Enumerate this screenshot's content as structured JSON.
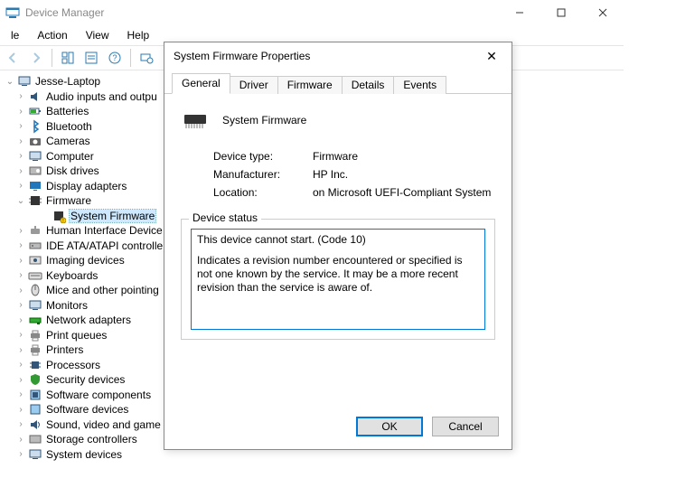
{
  "window": {
    "title": "Device Manager"
  },
  "menu": {
    "file": "le",
    "action": "Action",
    "view": "View",
    "help": "Help"
  },
  "tree": {
    "root": "Jesse-Laptop",
    "items": [
      "Audio inputs and outpu",
      "Batteries",
      "Bluetooth",
      "Cameras",
      "Computer",
      "Disk drives",
      "Display adapters",
      "Firmware",
      "Human Interface Device",
      "IDE ATA/ATAPI controlle",
      "Imaging devices",
      "Keyboards",
      "Mice and other pointing",
      "Monitors",
      "Network adapters",
      "Print queues",
      "Printers",
      "Processors",
      "Security devices",
      "Software components",
      "Software devices",
      "Sound, video and game",
      "Storage controllers",
      "System devices"
    ],
    "firmware_child": "System Firmware"
  },
  "dialog": {
    "title": "System Firmware Properties",
    "tabs": [
      "General",
      "Driver",
      "Firmware",
      "Details",
      "Events"
    ],
    "device_name": "System Firmware",
    "rows": {
      "type_k": "Device type:",
      "type_v": "Firmware",
      "mfr_k": "Manufacturer:",
      "mfr_v": "HP Inc.",
      "loc_k": "Location:",
      "loc_v": "on Microsoft UEFI-Compliant System"
    },
    "status_label": "Device status",
    "status_line1": "This device cannot start. (Code 10)",
    "status_line2": "Indicates a revision number encountered or specified is not one known by the service. It may be a more recent revision than the service is aware of.",
    "ok": "OK",
    "cancel": "Cancel"
  }
}
